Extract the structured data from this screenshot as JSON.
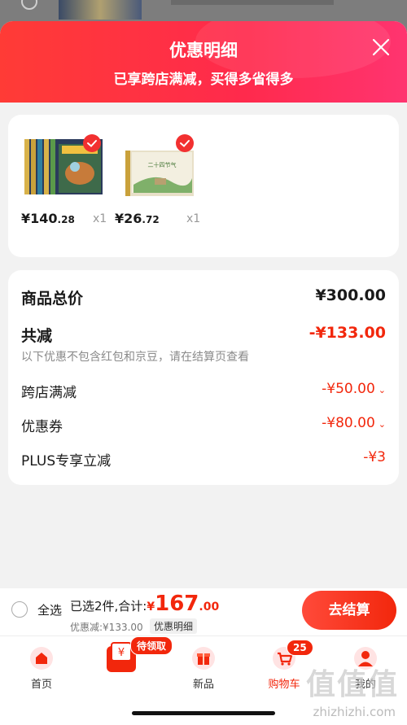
{
  "header": {
    "title": "优惠明细",
    "subtitle": "已享跨店满减，买得多省得多"
  },
  "products": [
    {
      "price_int": "¥140",
      "price_dec": ".28",
      "qty": "x1",
      "cover_text": ""
    },
    {
      "price_int": "¥26",
      "price_dec": ".72",
      "qty": "x1",
      "cover_text": "二十四节气"
    }
  ],
  "summary": {
    "total_label": "商品总价",
    "total_value": "¥300.00",
    "reduce_label": "共减",
    "reduce_value": "-¥133.00",
    "note": "以下优惠不包含红包和京豆，请在结算页查看",
    "items": [
      {
        "label": "跨店满减",
        "value": "-¥50.00",
        "has_chevron": true
      },
      {
        "label": "优惠券",
        "value": "-¥80.00",
        "has_chevron": true
      },
      {
        "label": "PLUS专享立减",
        "value": "-¥3",
        "has_chevron": false
      }
    ]
  },
  "bottombar": {
    "select_all": "全选",
    "selected_text": "已选2件,合计:",
    "currency": "¥",
    "amount": "167",
    "cents": ".00",
    "discount_text": "优惠减:¥133.00",
    "detail_label": "优惠明细",
    "checkout_label": "去结算"
  },
  "tabs": [
    {
      "label": "首页",
      "icon": "home-icon"
    },
    {
      "label": "",
      "icon": "coupon-icon",
      "badge": "待领取"
    },
    {
      "label": "新品",
      "icon": "gift-box-icon"
    },
    {
      "label": "购物车",
      "icon": "cart-icon",
      "badge": "25",
      "active": true
    },
    {
      "label": "我的",
      "icon": "profile-icon"
    }
  ],
  "watermark": {
    "text": "值值值",
    "url": "zhizhizhi.com"
  },
  "colors": {
    "accent": "#f2270c",
    "header_start": "#ff3b36",
    "header_end": "#ff3470"
  }
}
